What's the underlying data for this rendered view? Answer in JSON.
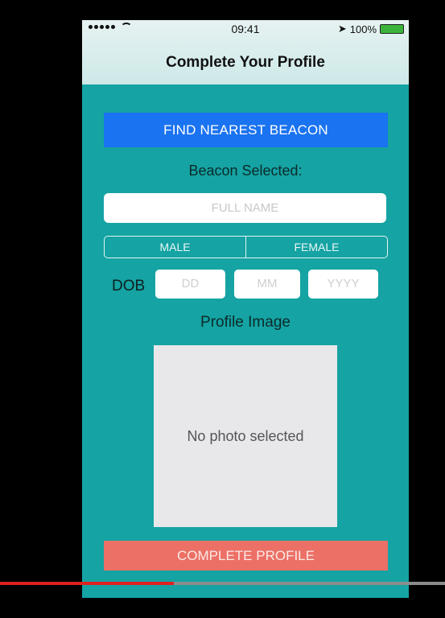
{
  "status_bar": {
    "time": "09:41",
    "battery_label": "100%"
  },
  "nav": {
    "title": "Complete Your Profile"
  },
  "form": {
    "find_beacon_label": "FIND NEAREST BEACON",
    "beacon_selected_label": "Beacon Selected:",
    "full_name_placeholder": "FULL NAME",
    "gender_options": [
      "MALE",
      "FEMALE"
    ],
    "dob_label": "DOB",
    "dob_day_placeholder": "DD",
    "dob_month_placeholder": "MM",
    "dob_year_placeholder": "YYYY",
    "profile_image_label": "Profile Image",
    "no_photo_text": "No photo selected",
    "complete_button_label": "COMPLETE PROFILE"
  },
  "video": {
    "progress_fraction": 0.39
  },
  "colors": {
    "background": "#15a3a3",
    "primary_button": "#1a73f0",
    "complete_button": "#ec7066"
  }
}
